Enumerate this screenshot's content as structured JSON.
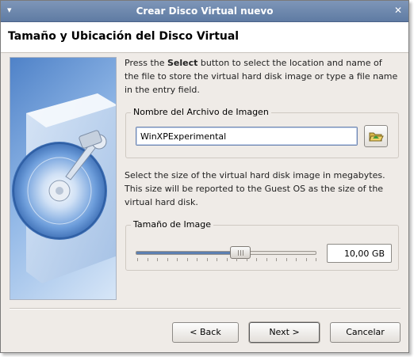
{
  "window": {
    "title": "Crear Disco Virtual nuevo"
  },
  "header": {
    "title": "Tamaño y Ubicación del Disco Virtual"
  },
  "location": {
    "description_before": "Press the ",
    "description_bold": "Select",
    "description_after": " button to select the location and name of the file to store the virtual hard disk image or type a file name in the entry field.",
    "group_label": "Nombre del Archivo de Imagen",
    "file_name_value": "WinXPExperimental",
    "select_button_icon": "folder-open-icon"
  },
  "size": {
    "description": "Select the size of the virtual hard disk image in megabytes. This size will be reported to the Guest OS as the size of the virtual hard disk.",
    "group_label": "Tamaño de Image",
    "value_text": "10,00 GB",
    "slider_fraction": 0.58
  },
  "buttons": {
    "back": "< Back",
    "next": "Next >",
    "cancel": "Cancelar"
  }
}
